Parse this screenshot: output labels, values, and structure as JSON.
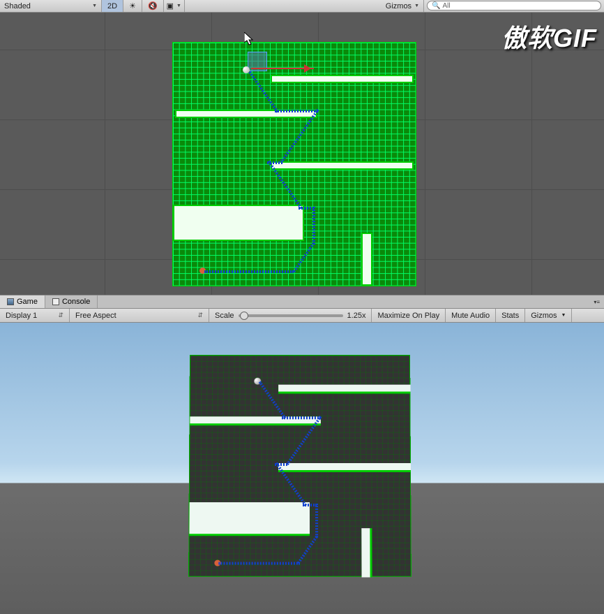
{
  "scene_toolbar": {
    "draw_mode": "Shaded",
    "dim_btn": "2D",
    "gizmos_label": "Gizmos",
    "search_prefix": "All"
  },
  "tabs": {
    "game": "Game",
    "console": "Console"
  },
  "game_toolbar": {
    "display": "Display 1",
    "aspect": "Free Aspect",
    "scale_label": "Scale",
    "scale_value": "1.25x",
    "maximize": "Maximize On Play",
    "mute": "Mute Audio",
    "stats": "Stats",
    "gizmos": "Gizmos"
  },
  "watermark": "傲软GIF",
  "icons": {
    "sun": "☀",
    "speaker": "🔇",
    "image": "▣",
    "search": "🔍"
  }
}
